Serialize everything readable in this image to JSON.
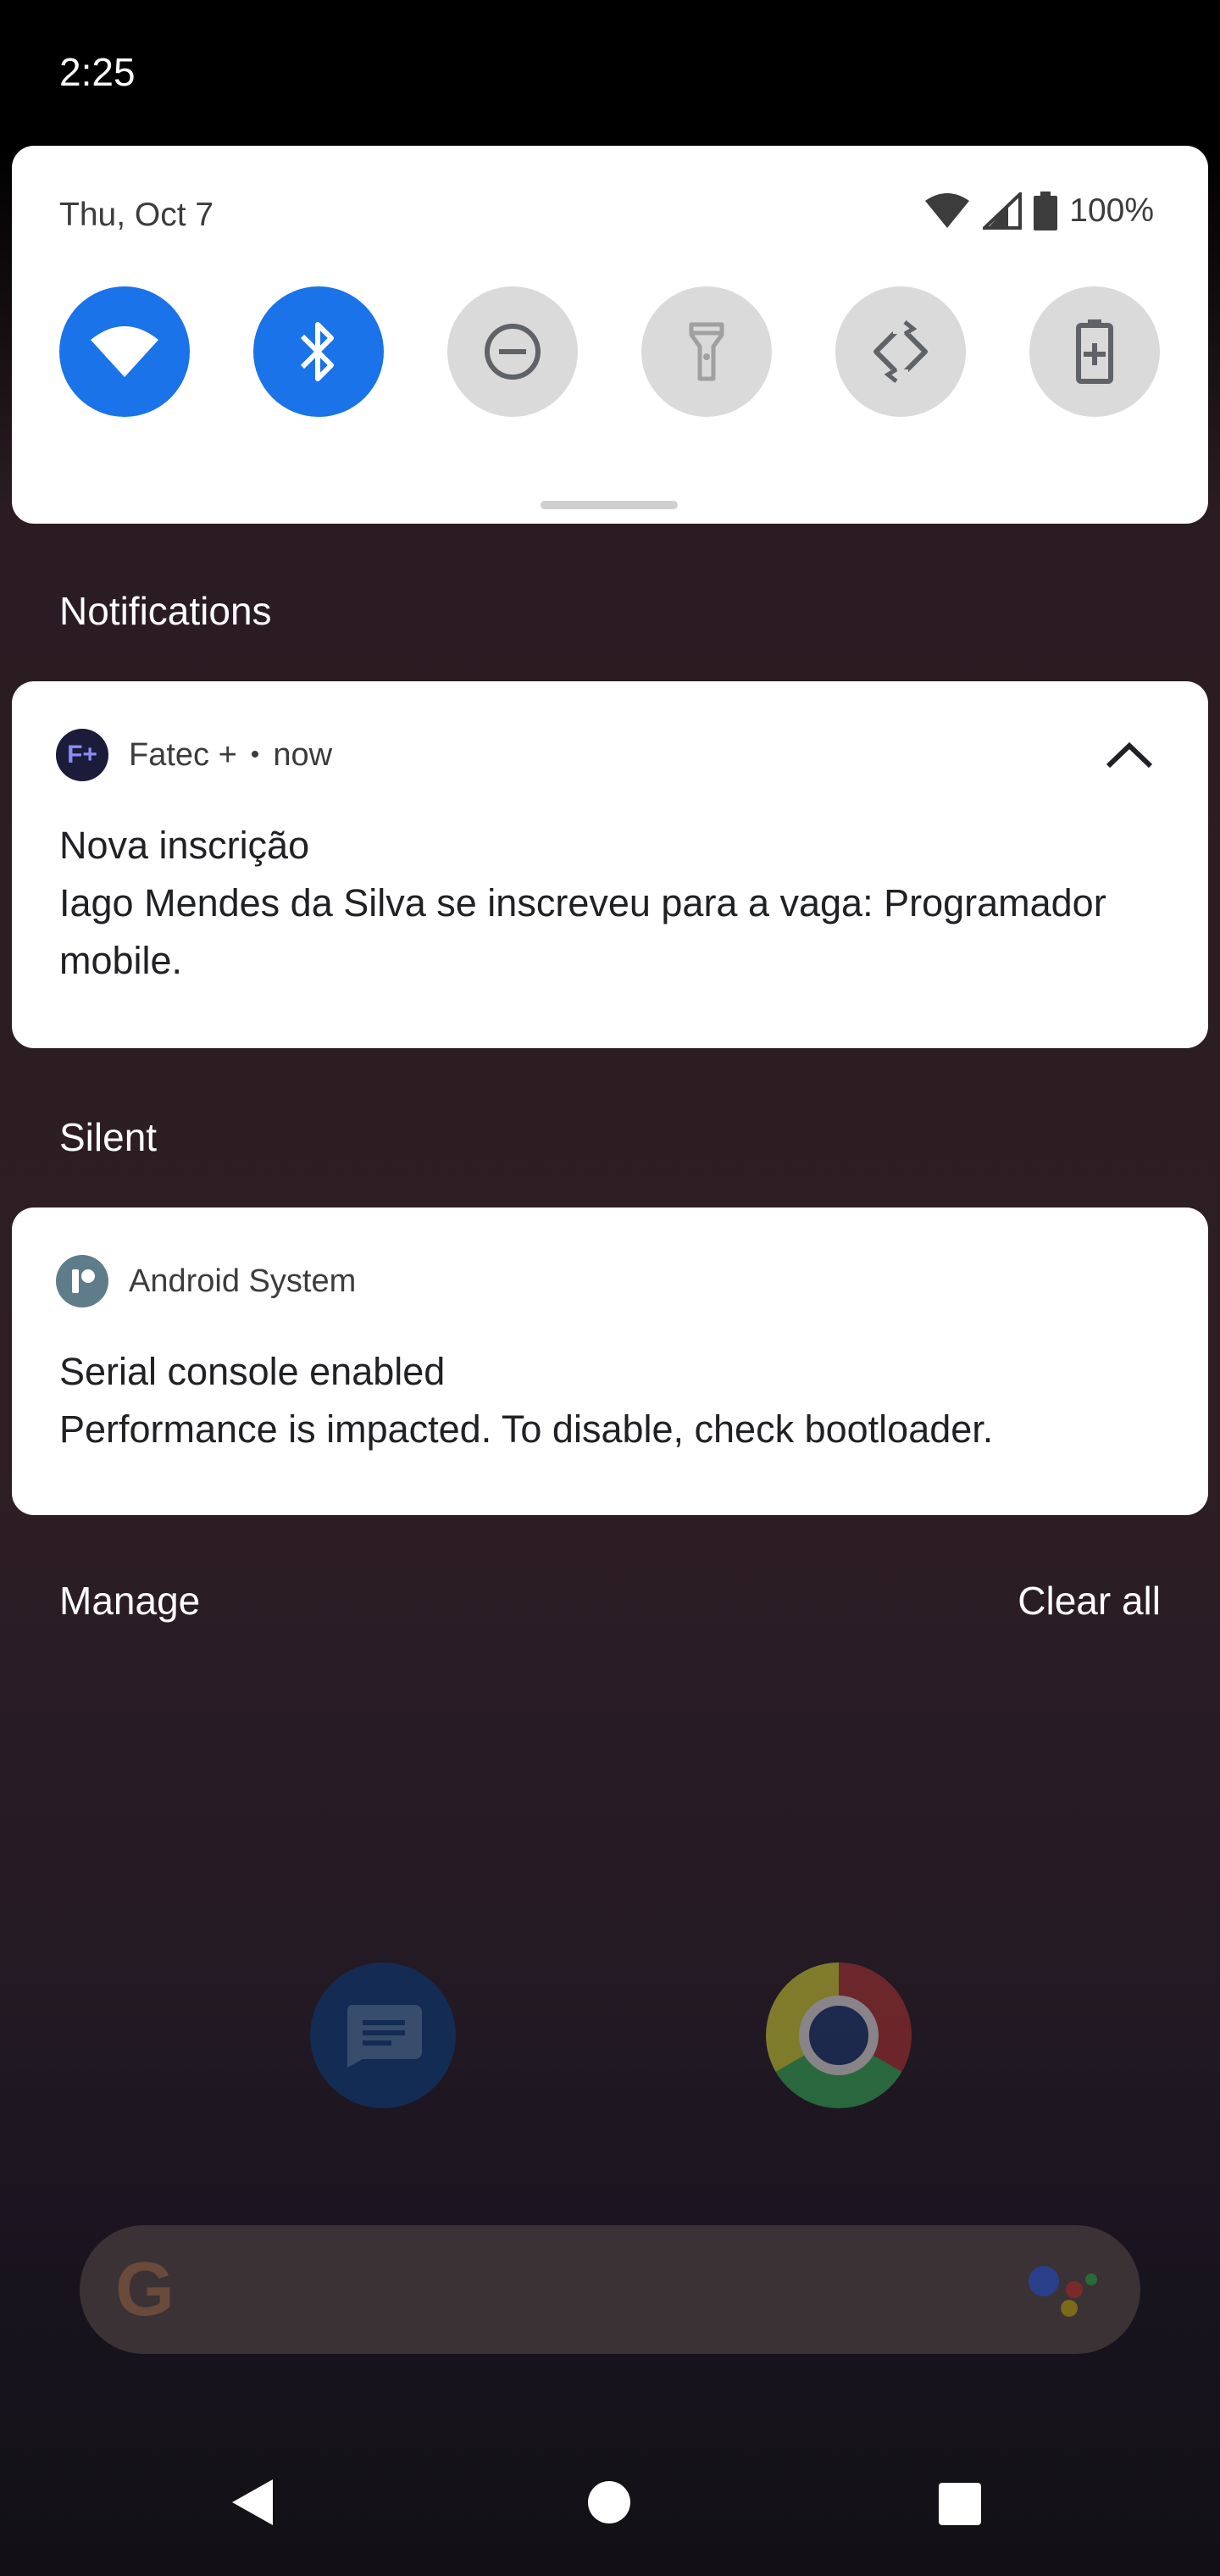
{
  "status_bar": {
    "time": "2:25"
  },
  "quick_settings": {
    "date": "Thu, Oct 7",
    "battery_percent": "100%",
    "tiles": [
      {
        "name": "wifi",
        "state": "on"
      },
      {
        "name": "bluetooth",
        "state": "on"
      },
      {
        "name": "do-not-disturb",
        "state": "off"
      },
      {
        "name": "flashlight",
        "state": "off"
      },
      {
        "name": "auto-rotate",
        "state": "off"
      },
      {
        "name": "battery-saver",
        "state": "off"
      }
    ]
  },
  "sections": {
    "notifications_title": "Notifications",
    "silent_title": "Silent"
  },
  "notifications": [
    {
      "app_icon_text": "F+",
      "app_name": "Fatec +",
      "separator": "•",
      "time": "now",
      "title": "Nova inscrição",
      "text": "Iago Mendes da Silva se inscreveu para a vaga: Programador mobile."
    },
    {
      "app_name": "Android System",
      "title": "Serial console enabled",
      "text": "Performance is impacted. To disable, check bootloader."
    }
  ],
  "actions": {
    "manage": "Manage",
    "clear_all": "Clear all"
  },
  "colors": {
    "accent": "#1a73e8",
    "tile_off": "#dadada",
    "card_bg": "#ffffff",
    "fatec_icon_bg": "#1b1b3a",
    "fatec_icon_fg": "#8a8cf5"
  }
}
